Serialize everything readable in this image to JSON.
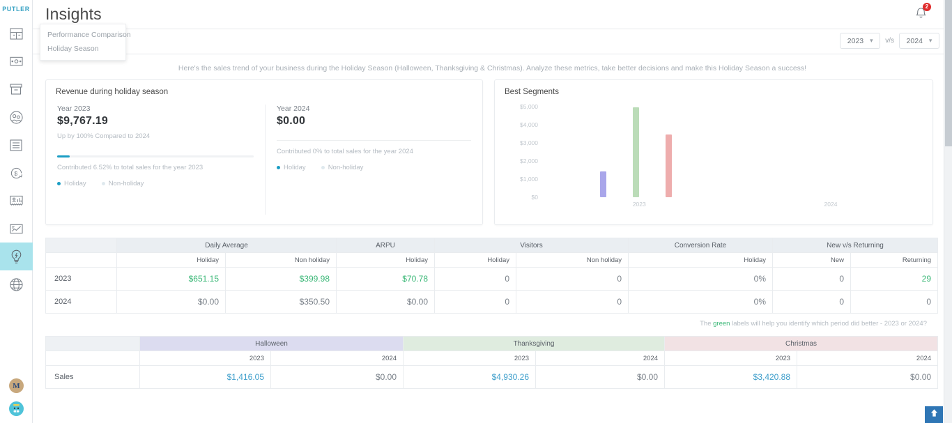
{
  "brand": "PUTLER",
  "header": {
    "title": "Insights",
    "notification_count": "2"
  },
  "sidebar": {
    "items": [
      {
        "name": "dashboard",
        "label": "Dashboard"
      },
      {
        "name": "sales",
        "label": "Sales"
      },
      {
        "name": "products",
        "label": "Products"
      },
      {
        "name": "audience",
        "label": "Audience"
      },
      {
        "name": "transactions",
        "label": "Transactions"
      },
      {
        "name": "subscriptions",
        "label": "Subscriptions"
      },
      {
        "name": "reports",
        "label": "Reports"
      },
      {
        "name": "trends",
        "label": "Trends"
      },
      {
        "name": "insights",
        "label": "Insights"
      },
      {
        "name": "web-analytics",
        "label": "Web Analytics"
      }
    ],
    "active_index": 8,
    "avatar_initial": "M"
  },
  "subbar": {
    "selected_view": "Holiday Season",
    "menu_items": [
      "Performance Comparison",
      "Holiday Season"
    ],
    "year_left": "2023",
    "year_right": "2024",
    "vs_label": "v/s"
  },
  "description": "Here's the sales trend of your business during the Holiday Season (Halloween, Thanksgiving & Christmas). Analyze these metrics, take better decisions and make this Holiday Season a success!",
  "revenue_card": {
    "title": "Revenue during holiday season",
    "left": {
      "year_label": "Year 2023",
      "amount": "$9,767.19",
      "note": "Up by 100% Compared to 2024",
      "contribution": "Contributed 6.52% to total sales for the year 2023",
      "progress_percent": 6.52
    },
    "right": {
      "year_label": "Year 2024",
      "amount": "$0.00",
      "contribution": "Contributed 0% to total sales for the year 2024"
    },
    "legend": [
      "Holiday",
      "Non-holiday"
    ]
  },
  "chart_data": {
    "type": "bar",
    "title": "Best Segments",
    "xlabel": "",
    "ylabel": "",
    "categories": [
      "2023",
      "2024"
    ],
    "ylim": [
      0,
      5000
    ],
    "yticks": [
      "$5,000",
      "$4,000",
      "$3,000",
      "$2,000",
      "$1,000",
      "$0"
    ],
    "grid": false,
    "legend_position": "none",
    "series": [
      {
        "name": "Halloween",
        "color": "#a9a6ea",
        "values": [
          1416.05,
          0
        ]
      },
      {
        "name": "Thanksgiving",
        "color": "#bbdcb8",
        "values": [
          4930.26,
          0
        ]
      },
      {
        "name": "Christmas",
        "color": "#eeadad",
        "values": [
          3420.88,
          0
        ]
      }
    ]
  },
  "metrics_table": {
    "groups": [
      {
        "label": "",
        "span": 1
      },
      {
        "label": "Daily Average",
        "span": 2
      },
      {
        "label": "ARPU",
        "span": 1
      },
      {
        "label": "Visitors",
        "span": 2
      },
      {
        "label": "Conversion Rate",
        "span": 1
      },
      {
        "label": "New v/s Returning",
        "span": 2
      }
    ],
    "subheaders": [
      "",
      "Holiday",
      "Non holiday",
      "Holiday",
      "Holiday",
      "Non holiday",
      "Holiday",
      "New",
      "Returning"
    ],
    "rows": [
      {
        "label": "2023",
        "cells": [
          "$651.15",
          "$399.98",
          "$70.78",
          "0",
          "0",
          "0%",
          "0",
          "29"
        ],
        "highlight": [
          true,
          true,
          true,
          false,
          false,
          false,
          false,
          true
        ]
      },
      {
        "label": "2024",
        "cells": [
          "$0.00",
          "$350.50",
          "$0.00",
          "0",
          "0",
          "0%",
          "0",
          "0"
        ],
        "highlight": [
          false,
          false,
          false,
          false,
          false,
          false,
          false,
          false
        ]
      }
    ]
  },
  "hint": {
    "prefix": "The ",
    "green_word": "green",
    "suffix": " labels will help you identify which period did better - 2023 or 2024?"
  },
  "holiday_table": {
    "groups": [
      {
        "label": "",
        "cls": "blank"
      },
      {
        "label": "Halloween",
        "cls": "hw"
      },
      {
        "label": "Thanksgiving",
        "cls": "tg"
      },
      {
        "label": "Christmas",
        "cls": "xm"
      }
    ],
    "subheaders": [
      "",
      "2023",
      "2024",
      "2023",
      "2024",
      "2023",
      "2024"
    ],
    "rows": [
      {
        "label": "Sales",
        "cells": [
          "$1,416.05",
          "$0.00",
          "$4,930.26",
          "$0.00",
          "$3,420.88",
          "$0.00"
        ],
        "highlight": [
          true,
          false,
          true,
          false,
          true,
          false
        ]
      }
    ]
  },
  "colors": {
    "accent": "#1b9dc4",
    "green": "#3cb878",
    "blue_value": "#3d9ecb",
    "active_nav": "#a9e3ec",
    "badge": "#e02b2b",
    "fab": "#2f76b5"
  }
}
